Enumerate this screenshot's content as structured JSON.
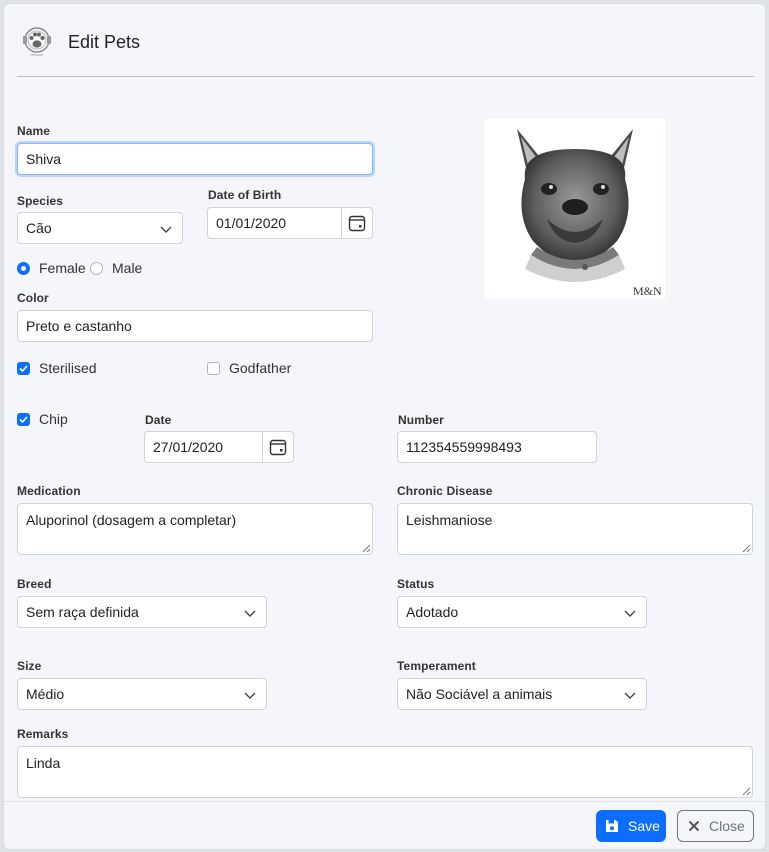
{
  "header": {
    "title": "Edit Pets",
    "icon": "paw-badge-icon"
  },
  "form": {
    "name": {
      "label": "Name",
      "value": "Shiva"
    },
    "species": {
      "label": "Species",
      "value": "Cão"
    },
    "dob": {
      "label": "Date of Birth",
      "value": "01/01/2020"
    },
    "gender": {
      "female_label": "Female",
      "male_label": "Male",
      "selected": "Female"
    },
    "color": {
      "label": "Color",
      "value": "Preto e castanho"
    },
    "sterilised": {
      "label": "Sterilised",
      "checked": true
    },
    "godfather": {
      "label": "Godfather",
      "checked": false
    },
    "chip": {
      "label": "Chip",
      "checked": true
    },
    "chip_date": {
      "label": "Date",
      "value": "27/01/2020"
    },
    "chip_number": {
      "label": "Number",
      "value": "112354559998493"
    },
    "medication": {
      "label": "Medication",
      "value": "Aluporinol (dosagem a completar)"
    },
    "chronic_disease": {
      "label": "Chronic Disease",
      "value": "Leishmaniose"
    },
    "breed": {
      "label": "Breed",
      "value": "Sem raça definida"
    },
    "status": {
      "label": "Status",
      "value": "Adotado"
    },
    "size": {
      "label": "Size",
      "value": "Médio"
    },
    "temperament": {
      "label": "Temperament",
      "value": "Não Sociável a animais"
    },
    "remarks": {
      "label": "Remarks",
      "value": "Linda"
    }
  },
  "photo": {
    "signature": "M&N"
  },
  "footer": {
    "save_label": "Save",
    "close_label": "Close"
  },
  "colors": {
    "accent": "#0d6efd",
    "secondary": "#6c757d",
    "background": "#f4f6f9"
  }
}
